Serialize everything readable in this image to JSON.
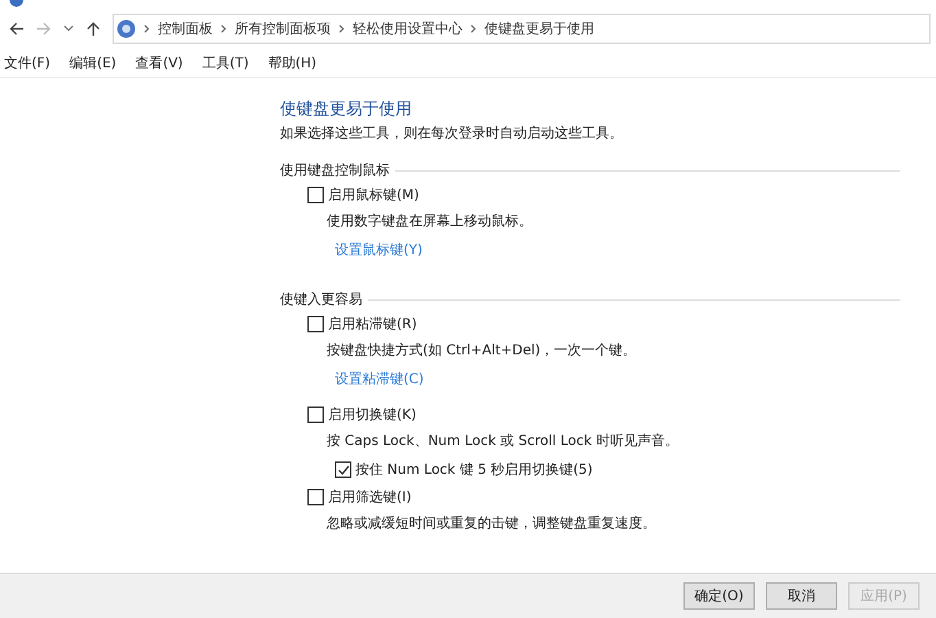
{
  "breadcrumbs": [
    "控制面板",
    "所有控制面板项",
    "轻松使用设置中心",
    "使键盘更易于使用"
  ],
  "menu": [
    "文件(F)",
    "编辑(E)",
    "查看(V)",
    "工具(T)",
    "帮助(H)"
  ],
  "page": {
    "title": "使键盘更易于使用",
    "description": "如果选择这些工具，则在每次登录时自动启动这些工具。"
  },
  "sections": [
    {
      "title": "使用键盘控制鼠标",
      "items": [
        {
          "kind": "checkbox",
          "label": "启用鼠标键(M)",
          "checked": false
        },
        {
          "kind": "text",
          "text": "使用数字键盘在屏幕上移动鼠标。"
        },
        {
          "kind": "link",
          "text": "设置鼠标键(Y)"
        }
      ]
    },
    {
      "title": "使键入更容易",
      "items": [
        {
          "kind": "checkbox",
          "label": "启用粘滞键(R)",
          "checked": false
        },
        {
          "kind": "text",
          "text": "按键盘快捷方式(如 Ctrl+Alt+Del)，一次一个键。"
        },
        {
          "kind": "link",
          "text": "设置粘滞键(C)"
        },
        {
          "kind": "checkbox",
          "label": "启用切换键(K)",
          "checked": false
        },
        {
          "kind": "text",
          "text": "按 Caps Lock、Num Lock 或 Scroll Lock 时听见声音。"
        },
        {
          "kind": "sub_checkbox",
          "label": "按住 Num Lock 键 5 秒启用切换键(5)",
          "checked": true
        },
        {
          "kind": "checkbox",
          "label": "启用筛选键(I)",
          "checked": false
        },
        {
          "kind": "text",
          "text": "忽略或减缓短时间或重复的击键，调整键盘重复速度。"
        }
      ]
    }
  ],
  "buttons": [
    {
      "label": "确定(O)",
      "disabled": false
    },
    {
      "label": "取消",
      "disabled": false
    },
    {
      "label": "应用(P)",
      "disabled": true
    }
  ]
}
